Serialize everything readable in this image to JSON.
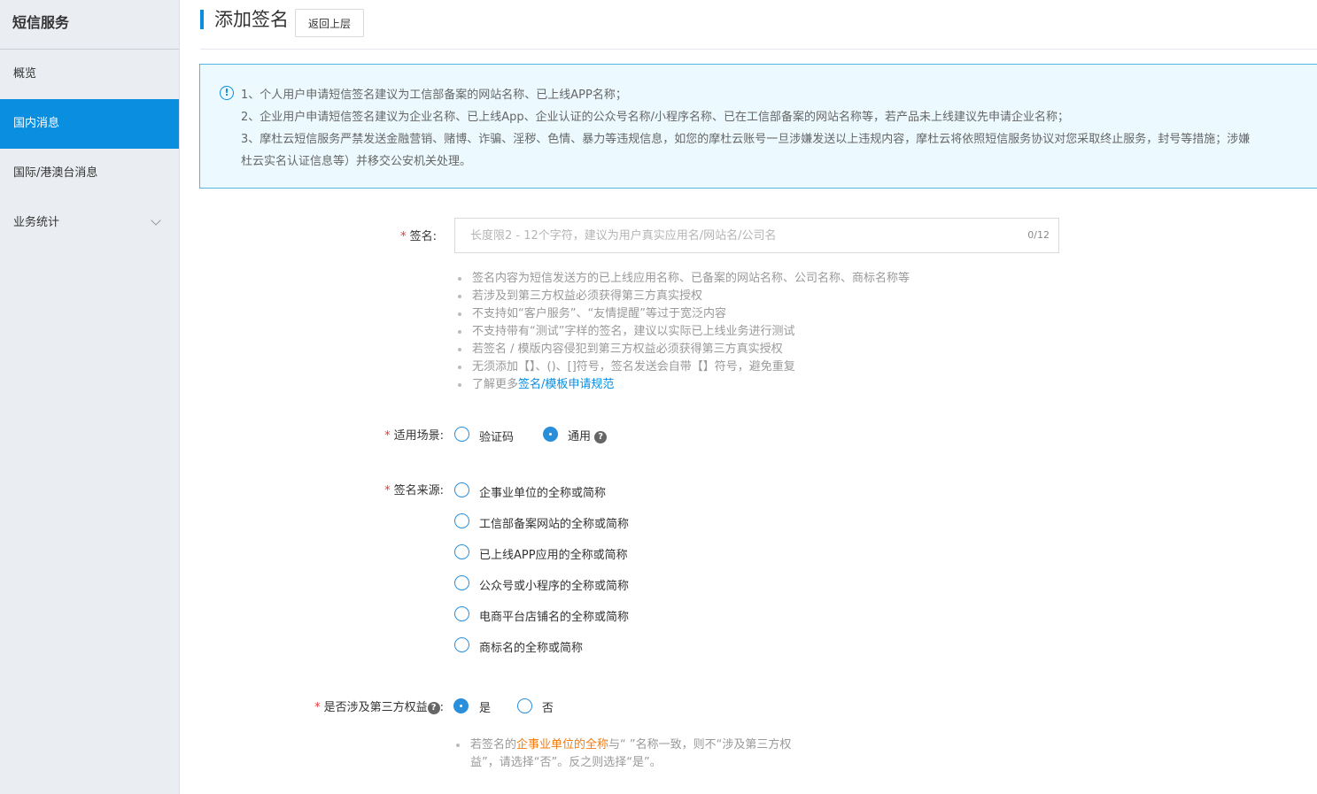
{
  "sidebar": {
    "title": "短信服务",
    "items": [
      {
        "label": "概览"
      },
      {
        "label": "国内消息"
      },
      {
        "label": "国际/港澳台消息"
      },
      {
        "label": "业务统计"
      }
    ]
  },
  "header": {
    "title": "添加签名",
    "back_label": "返回上层"
  },
  "notice": {
    "lines": [
      "1、个人用户申请短信签名建议为工信部备案的网站名称、已上线APP名称；",
      "2、企业用户申请短信签名建议为企业名称、已上线App、企业认证的公众号名称/小程序名称、已在工信部备案的网站名称等，若产品未上线建议先申请企业名称；",
      "3、摩杜云短信服务严禁发送金融营销、赌博、诈骗、淫秽、色情、暴力等违规信息，如您的摩杜云账号一旦涉嫌发送以上违规内容，摩杜云将依照短信服务协议对您采取终止服务，封号等措施；涉嫌",
      "杜云实名认证信息等）并移交公安机关处理。"
    ]
  },
  "form": {
    "signature": {
      "label": "签名:",
      "placeholder": "长度限2 - 12个字符，建议为用户真实应用名/网站名/公司名",
      "value": "",
      "count": "0/12"
    },
    "tips": [
      "签名内容为短信发送方的已上线应用名称、已备案的网站名称、公司名称、商标名称等",
      "若涉及到第三方权益必须获得第三方真实授权",
      "不支持如“客户服务”、“友情提醒”等过于宽泛内容",
      "不支持带有“测试”字样的签名，建议以实际已上线业务进行测试",
      "若签名 / 模版内容侵犯到第三方权益必须获得第三方真实授权",
      "无须添加【】、()、[]符号，签名发送会自带【】符号，避免重复"
    ],
    "tip_more": {
      "prefix": "了解更多",
      "link": "签名/模板申请规范"
    },
    "scene": {
      "label": "适用场景:",
      "options": [
        {
          "label": "验证码",
          "checked": false
        },
        {
          "label": "通用",
          "checked": true
        }
      ]
    },
    "source": {
      "label": "签名来源:",
      "options": [
        {
          "label": "企事业单位的全称或简称",
          "checked": false
        },
        {
          "label": "工信部备案网站的全称或简称",
          "checked": false
        },
        {
          "label": "已上线APP应用的全称或简称",
          "checked": false
        },
        {
          "label": "公众号或小程序的全称或简称",
          "checked": false
        },
        {
          "label": "电商平台店铺名的全称或简称",
          "checked": false
        },
        {
          "label": "商标名的全称或简称",
          "checked": false
        }
      ]
    },
    "third_party": {
      "label": "是否涉及第三方权益",
      "colon": ":",
      "options": [
        {
          "label": "是",
          "checked": true
        },
        {
          "label": "否",
          "checked": false
        }
      ],
      "hint_prefix": "若签名的",
      "hint_highlight": "企事业单位的全称",
      "hint_suffix": "与“ ”名称一致，则不“涉及第三方权",
      "hint_line2": "益”，请选择“否”。反之则选择“是”。"
    }
  },
  "colors": {
    "accent": "#0a8ee0",
    "required": "#e4393c",
    "highlight": "#f07c12",
    "notice_bg": "#ecfaff"
  }
}
